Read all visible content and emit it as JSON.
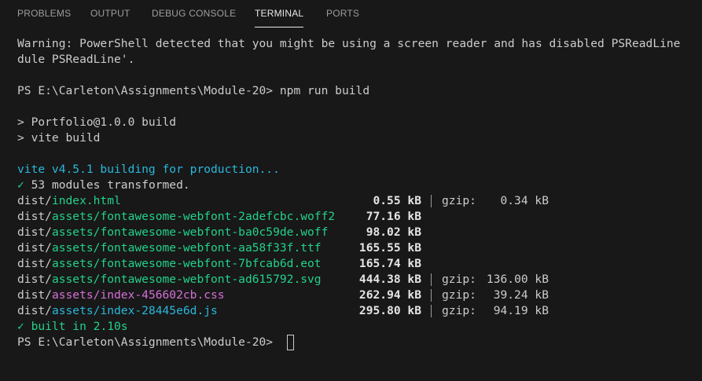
{
  "tabs": [
    {
      "label": "PROBLEMS"
    },
    {
      "label": "OUTPUT"
    },
    {
      "label": "DEBUG CONSOLE"
    },
    {
      "label": "TERMINAL"
    },
    {
      "label": "PORTS"
    }
  ],
  "active_tab": "TERMINAL",
  "terminal": {
    "warning_line1": "Warning: PowerShell detected that you might be using a screen reader and has disabled PSReadLine",
    "warning_line2": "dule PSReadLine'.",
    "prompt": "PS E:\\Carleton\\Assignments\\Module-20>",
    "command": " npm run build",
    "script_line1": "> Portfolio@1.0.0 build",
    "script_line2": "> vite build",
    "vite_status": "vite v4.5.1 building for production...",
    "transformed_check": "✓",
    "transformed_text": " 53 modules transformed.",
    "outputs": [
      {
        "dir": "dist/",
        "path": "index.html",
        "color": "#23d18b",
        "size": "0.55 kB",
        "gzip_label": "gzip:",
        "gzip_size": "0.34 kB"
      },
      {
        "dir": "dist/",
        "path": "assets/fontawesome-webfont-2adefcbc.woff2",
        "color": "#23d18b",
        "size": "77.16 kB",
        "gzip_label": "",
        "gzip_size": ""
      },
      {
        "dir": "dist/",
        "path": "assets/fontawesome-webfont-ba0c59de.woff",
        "color": "#23d18b",
        "size": "98.02 kB",
        "gzip_label": "",
        "gzip_size": ""
      },
      {
        "dir": "dist/",
        "path": "assets/fontawesome-webfont-aa58f33f.ttf",
        "color": "#23d18b",
        "size": "165.55 kB",
        "gzip_label": "",
        "gzip_size": ""
      },
      {
        "dir": "dist/",
        "path": "assets/fontawesome-webfont-7bfcab6d.eot",
        "color": "#23d18b",
        "size": "165.74 kB",
        "gzip_label": "",
        "gzip_size": ""
      },
      {
        "dir": "dist/",
        "path": "assets/fontawesome-webfont-ad615792.svg",
        "color": "#23d18b",
        "size": "444.38 kB",
        "gzip_label": "gzip:",
        "gzip_size": "136.00 kB"
      },
      {
        "dir": "dist/",
        "path": "assets/index-456602cb.css",
        "color": "#d670d6",
        "size": "262.94 kB",
        "gzip_label": "gzip:",
        "gzip_size": "39.24 kB"
      },
      {
        "dir": "dist/",
        "path": "assets/index-28445e6d.js",
        "color": "#29b8db",
        "size": "295.80 kB",
        "gzip_label": "gzip:",
        "gzip_size": "94.19 kB"
      }
    ],
    "built_check": "✓",
    "built_text": " built in 2.10s",
    "final_prompt": "PS E:\\Carleton\\Assignments\\Module-20>"
  },
  "colors": {
    "background": "#181818",
    "text": "#cccccc",
    "green": "#23d18b",
    "cyan": "#29b8db",
    "magenta": "#d670d6",
    "tab_active": "#e7e7e7",
    "tab_inactive": "#9d9d9d"
  }
}
